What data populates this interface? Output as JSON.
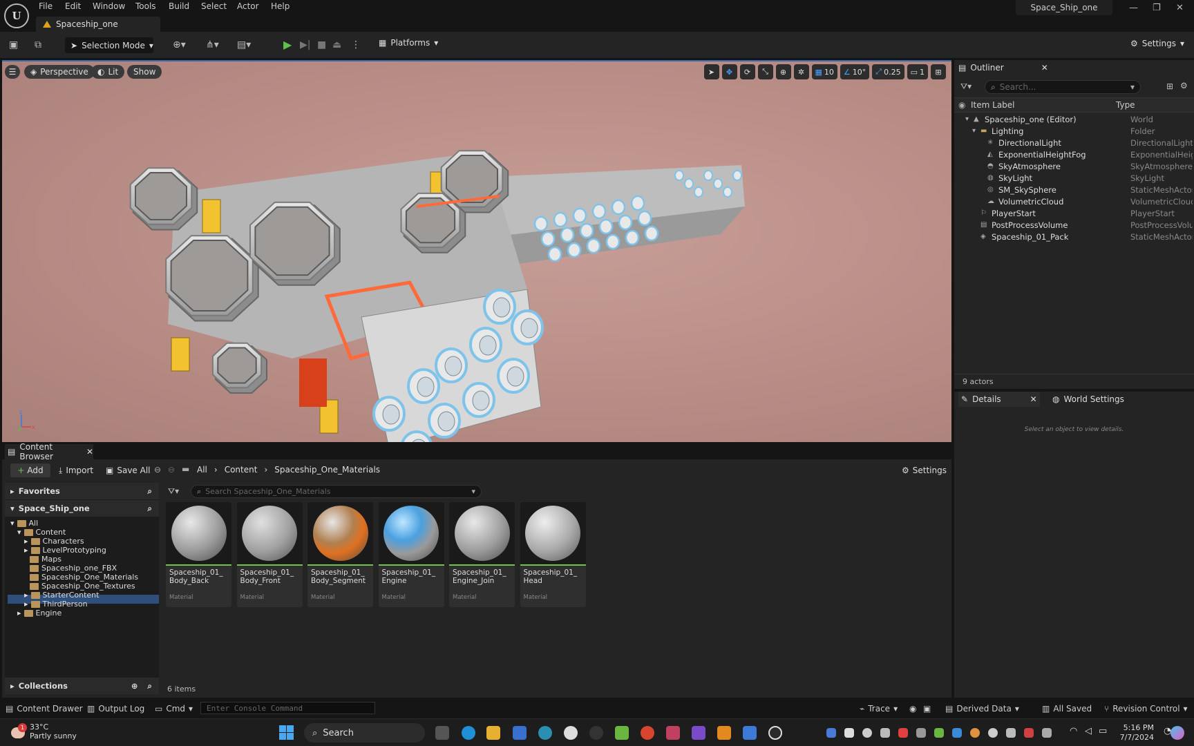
{
  "app": {
    "menus": [
      "File",
      "Edit",
      "Window",
      "Tools",
      "Build",
      "Select",
      "Actor",
      "Help"
    ],
    "doc_tab": "Spaceship_one",
    "project": "Space_Ship_one"
  },
  "toolbar": {
    "selection_mode": "Selection Mode",
    "platforms": "Platforms",
    "settings": "Settings"
  },
  "viewport": {
    "perspective": "Perspective",
    "lit": "Lit",
    "show": "Show",
    "grid_snap": "10",
    "rot_snap": "10°",
    "scale_snap": "0.25",
    "camera_speed": "1",
    "colors": {
      "background": "#c09690",
      "hull": "#cfcfcf",
      "accent": "#f2c230",
      "glow": "#ff6a3a",
      "nozzle": "#7ec4ea"
    }
  },
  "outliner": {
    "tab": "Outliner",
    "search_placeholder": "Search...",
    "col_label": "Item Label",
    "col_type": "Type",
    "rows": [
      {
        "label": "Spaceship_one (Editor)",
        "type": "World"
      },
      {
        "label": "Lighting",
        "type": "Folder"
      },
      {
        "label": "DirectionalLight",
        "type": "DirectionalLight"
      },
      {
        "label": "ExponentialHeightFog",
        "type": "ExponentialHeigh"
      },
      {
        "label": "SkyAtmosphere",
        "type": "SkyAtmosphere"
      },
      {
        "label": "SkyLight",
        "type": "SkyLight"
      },
      {
        "label": "SM_SkySphere",
        "type": "StaticMeshActor"
      },
      {
        "label": "VolumetricCloud",
        "type": "VolumetricCloud"
      },
      {
        "label": "PlayerStart",
        "type": "PlayerStart"
      },
      {
        "label": "PostProcessVolume",
        "type": "PostProcessVolu"
      },
      {
        "label": "Spaceship_01_Pack",
        "type": "StaticMeshActor"
      }
    ],
    "actor_count": "9 actors"
  },
  "details": {
    "tab": "Details",
    "world_settings": "World Settings",
    "hint": "Select an object to view details."
  },
  "content_browser": {
    "tab": "Content Browser",
    "add": "Add",
    "import": "Import",
    "save_all": "Save All",
    "breadcrumbs": [
      "All",
      "Content",
      "Spaceship_One_Materials"
    ],
    "settings": "Settings",
    "favorites": "Favorites",
    "project": "Space_Ship_one",
    "tree": [
      "All",
      "Content",
      "Characters",
      "LevelPrototyping",
      "Maps",
      "Spaceship_one_FBX",
      "Spaceship_One_Materials",
      "Spaceship_One_Textures",
      "StarterContent",
      "ThirdPerson",
      "Engine"
    ],
    "collections": "Collections",
    "search_placeholder": "Search Spaceship_One_Materials",
    "items_count": "6 items",
    "assets": [
      {
        "line1": "Spaceship_01_",
        "line2": "Body_Back",
        "type": "Material"
      },
      {
        "line1": "Spaceship_01_",
        "line2": "Body_Front",
        "type": "Material"
      },
      {
        "line1": "Spaceship_01_",
        "line2": "Body_Segment",
        "type": "Material"
      },
      {
        "line1": "Spaceship_01_",
        "line2": "Engine",
        "type": "Material"
      },
      {
        "line1": "Spaceship_01_",
        "line2": "Engine_Join",
        "type": "Material"
      },
      {
        "line1": "Spaceship_01_",
        "line2": "Head",
        "type": "Material"
      }
    ]
  },
  "statusbar": {
    "content_drawer": "Content Drawer",
    "output_log": "Output Log",
    "cmd": "Cmd",
    "console_placeholder": "Enter Console Command",
    "trace": "Trace",
    "derived_data": "Derived Data",
    "all_saved": "All Saved",
    "revision_control": "Revision Control"
  },
  "taskbar": {
    "temp": "33°C",
    "weather": "Partly sunny",
    "search": "Search",
    "time": "5:16 PM",
    "date": "7/7/2024",
    "notif": "1"
  }
}
